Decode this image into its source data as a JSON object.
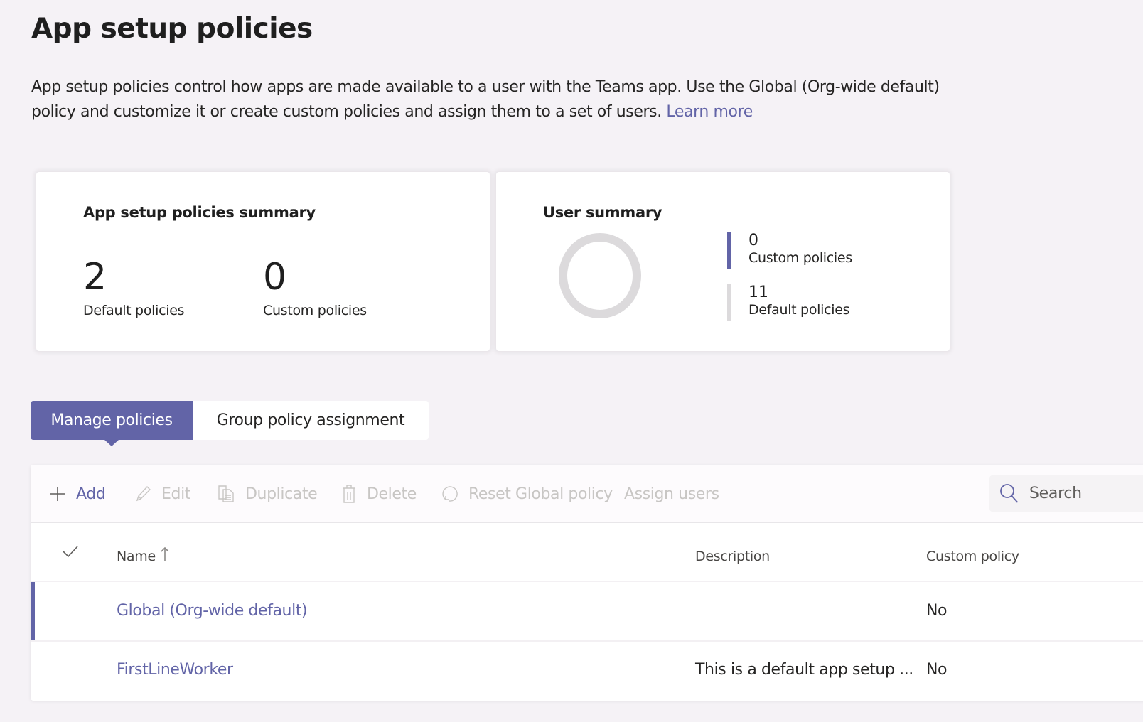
{
  "page": {
    "title": "App setup policies",
    "intro_text": "App setup policies control how apps are made available to a user with the Teams app. Use the Global (Org-wide default) policy and customize it or create custom policies and assign them to a set of users.",
    "learn_more_label": "Learn more"
  },
  "colors": {
    "accent": "#6264a7",
    "donut_track": "#dcdadc",
    "legend_default": "#dcdadc",
    "disabled_text": "#c8c6c4"
  },
  "policies_summary": {
    "title": "App setup policies summary",
    "stats": [
      {
        "value": "2",
        "label": "Default policies"
      },
      {
        "value": "0",
        "label": "Custom policies"
      }
    ]
  },
  "user_summary": {
    "title": "User summary",
    "legend": [
      {
        "value": "0",
        "label": "Custom policies",
        "color": "#6264a7"
      },
      {
        "value": "11",
        "label": "Default policies",
        "color": "#dcdadc"
      }
    ],
    "donut_values": {
      "custom": 0,
      "default": 11
    }
  },
  "tabs": [
    {
      "label": "Manage policies",
      "active": true
    },
    {
      "label": "Group policy assignment",
      "active": false
    }
  ],
  "toolbar": {
    "add": {
      "label": "Add",
      "icon": "plus-icon",
      "enabled": true
    },
    "edit": {
      "label": "Edit",
      "icon": "pencil-icon",
      "enabled": false
    },
    "duplicate": {
      "label": "Duplicate",
      "icon": "copy-icon",
      "enabled": false
    },
    "delete": {
      "label": "Delete",
      "icon": "trash-icon",
      "enabled": false
    },
    "reset": {
      "label": "Reset Global policy",
      "icon": "reset-icon",
      "enabled": false
    },
    "assign": {
      "label": "Assign users",
      "enabled": false
    },
    "search": {
      "placeholder": "Search",
      "icon": "search-icon"
    }
  },
  "table": {
    "columns": {
      "select": "check-icon",
      "name": "Name",
      "name_sort": "ascending",
      "description": "Description",
      "custom_policy": "Custom policy"
    },
    "rows": [
      {
        "name": "Global (Org-wide default)",
        "description": "",
        "custom_policy": "No",
        "selected": true
      },
      {
        "name": "FirstLineWorker",
        "description": "This is a default app setup ...",
        "custom_policy": "No",
        "selected": false
      }
    ]
  }
}
